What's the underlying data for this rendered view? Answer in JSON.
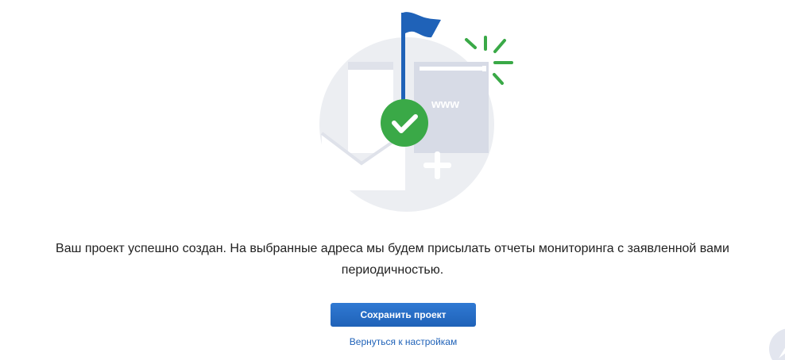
{
  "illustration": {
    "www_label": "www",
    "colors": {
      "circle": "#eceef2",
      "panel": "#d7dbe6",
      "flag": "#1f62b8",
      "check": "#3aa947"
    },
    "icons": [
      "flag-icon",
      "check-icon",
      "plus-icon",
      "browser-window-icon",
      "envelope-icon",
      "sparkle-icon"
    ]
  },
  "message": {
    "text": "Ваш проект успешно создан. На выбранные адреса мы будем присылать отчеты мониторинга с заявленной вами периодичностью."
  },
  "actions": {
    "save_label": "Сохранить проект",
    "back_label": "Вернуться к настройкам"
  },
  "colors": {
    "accent": "#1f62b8",
    "text": "#222222"
  }
}
